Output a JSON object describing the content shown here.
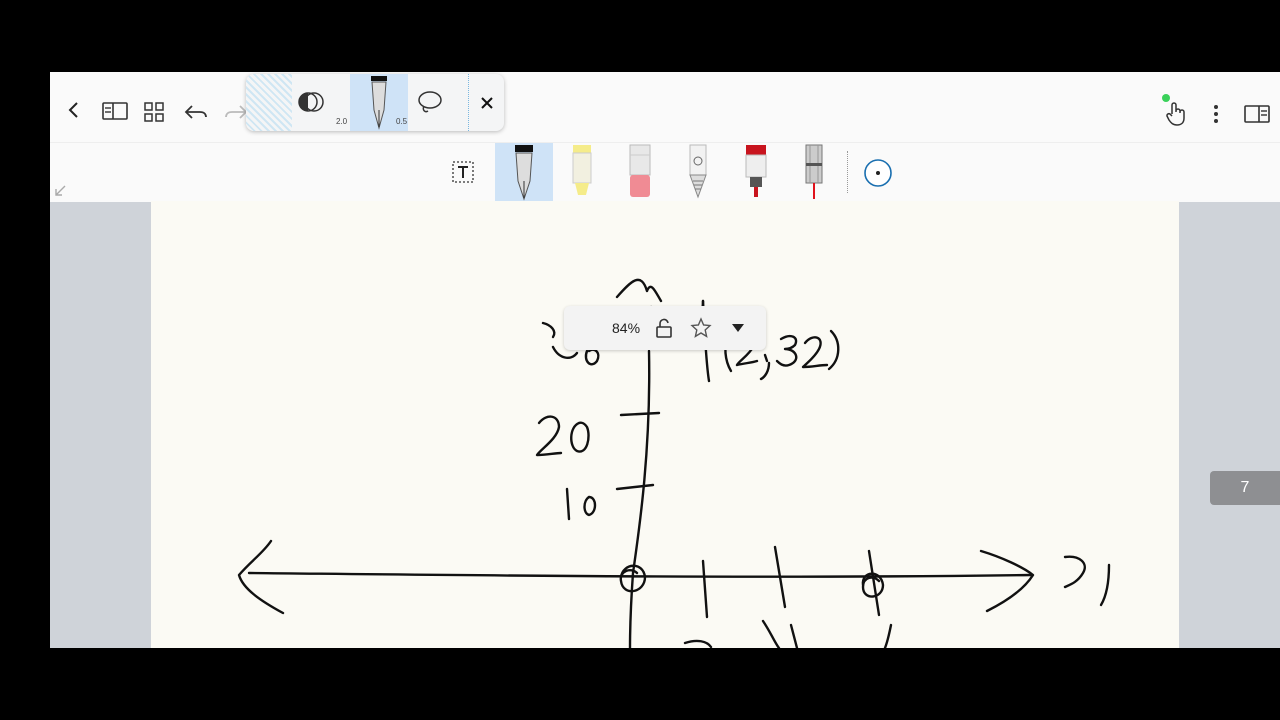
{
  "toolbar": {
    "back": "back-icon",
    "pen_sizes": {
      "left": "2.0",
      "right": "0.5"
    }
  },
  "zoom": {
    "level": "84%"
  },
  "page": {
    "number": "7"
  },
  "colors": {
    "selected_tool": "#cfe3f7",
    "accent": "#1a6fb0",
    "canvas": "#fbfaf4",
    "status_dot": "#3ad15a"
  }
}
